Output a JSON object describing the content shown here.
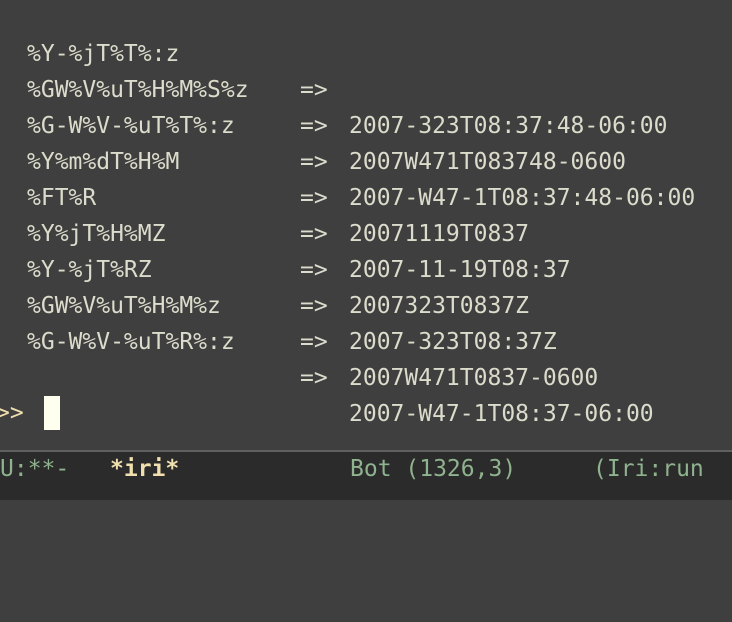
{
  "buffer": {
    "rows": [
      {
        "format": "%Y-%jT%T%:z",
        "arrow": "=>",
        "result": "2007-323T08:37:48-06:00"
      },
      {
        "format": "%GW%V%uT%H%M%S%z",
        "arrow": "=>",
        "result": "2007W471T083748-0600"
      },
      {
        "format": "%G-W%V-%uT%T%:z",
        "arrow": "=>",
        "result": "2007-W47-1T08:37:48-06:00"
      },
      {
        "format": "%Y%m%dT%H%M",
        "arrow": "=>",
        "result": "20071119T0837"
      },
      {
        "format": "%FT%R",
        "arrow": "=>",
        "result": "2007-11-19T08:37"
      },
      {
        "format": "%Y%jT%H%MZ",
        "arrow": "=>",
        "result": "2007323T0837Z"
      },
      {
        "format": "%Y-%jT%RZ",
        "arrow": "=>",
        "result": "2007-323T08:37Z"
      },
      {
        "format": "%GW%V%uT%H%M%z",
        "arrow": "=>",
        "result": "2007W471T0837-0600"
      },
      {
        "format": "%G-W%V-%uT%R%:z",
        "arrow": "=>",
        "result": "2007-W47-1T08:37-06:00"
      }
    ],
    "prompt": ">>"
  },
  "mode_line": {
    "status": "U:**-",
    "buffer_name": "*iri*",
    "position": "Bot (1326,3)",
    "mode": "(Iri:run"
  },
  "colors": {
    "background": "#3f3f3f",
    "foreground": "#dcdccc",
    "prompt": "#f0dfaf",
    "mode_line_background": "#2b2b2b",
    "mode_line_foreground": "#8fb28f"
  }
}
